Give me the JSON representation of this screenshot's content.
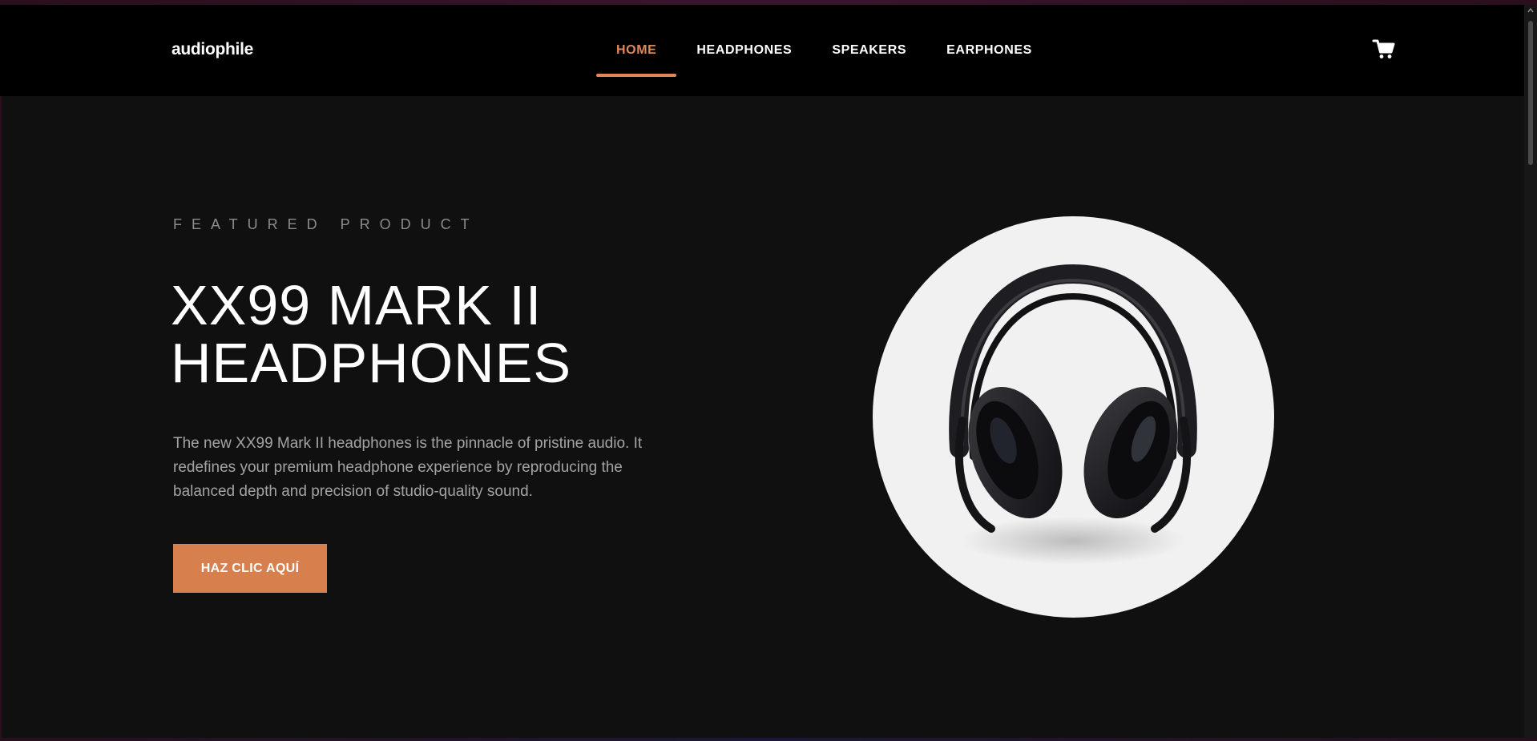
{
  "brand": {
    "logo_text": "audiophile",
    "accent_color": "#e0875a"
  },
  "nav": {
    "items": [
      {
        "label": "HOME",
        "active": true
      },
      {
        "label": "HEADPHONES",
        "active": false
      },
      {
        "label": "SPEAKERS",
        "active": false
      },
      {
        "label": "EARPHONES",
        "active": false
      }
    ],
    "cart_icon": "shopping-cart-icon"
  },
  "hero": {
    "overline": "FEATURED PRODUCT",
    "title_line1": "XX99 MARK II",
    "title_line2": "HEADPHONES",
    "description": "The new XX99 Mark II headphones is the pinnacle of pristine audio. It redefines your premium headphone experience by reproducing the balanced depth and precision of studio-quality sound.",
    "cta_label": "HAZ CLIC AQUÍ",
    "cta_color": "#d7804d",
    "image_icon": "headphones-image"
  }
}
